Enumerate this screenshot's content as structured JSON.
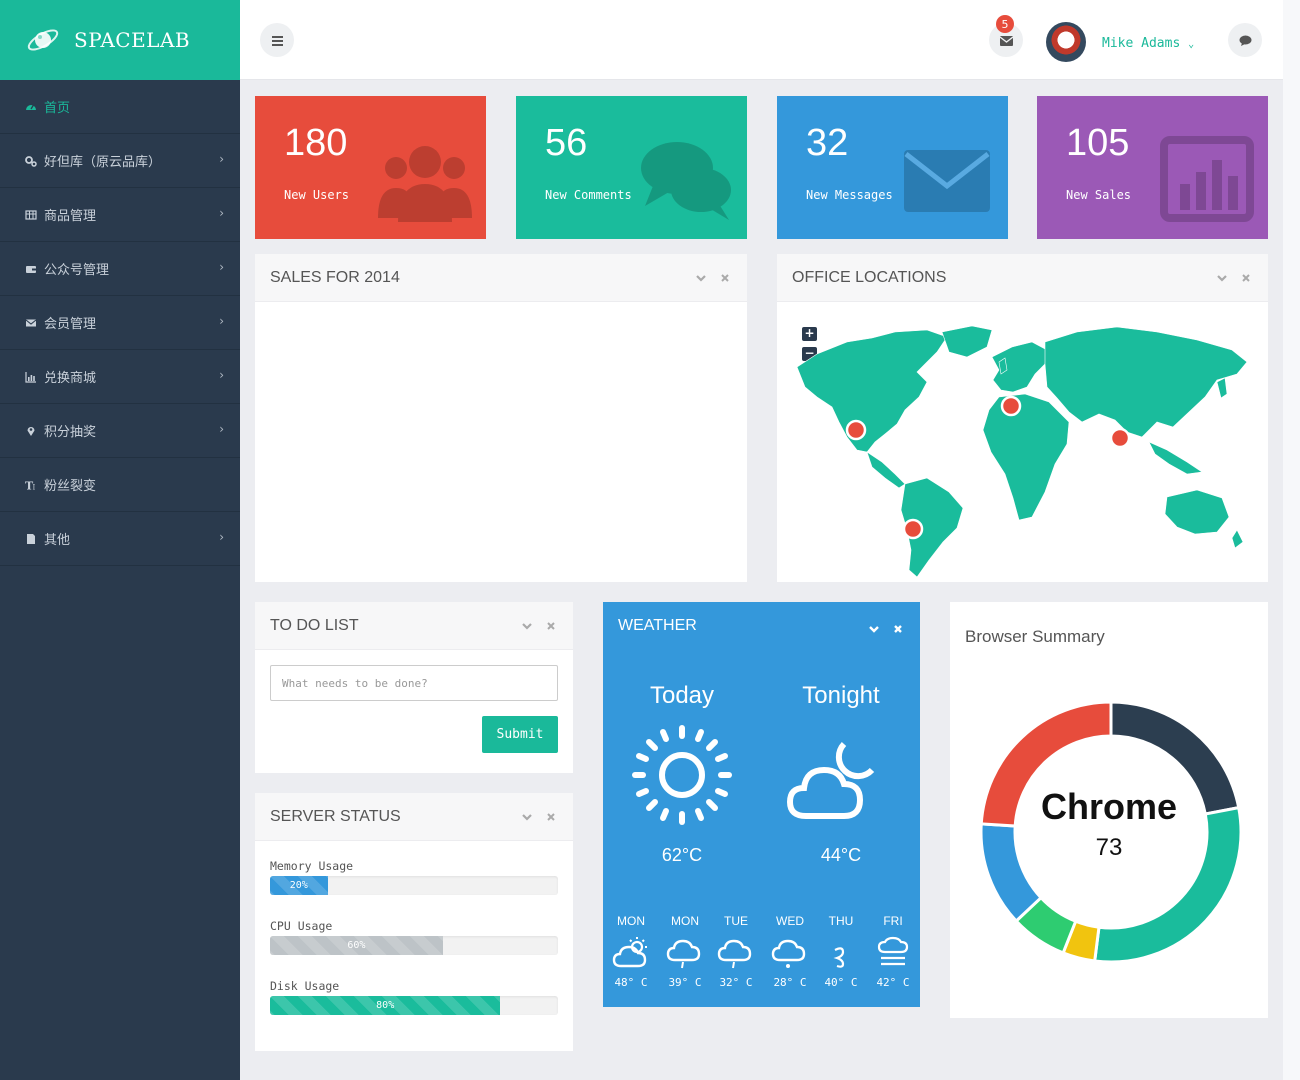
{
  "brand": {
    "name": "SPACELAB"
  },
  "sidebar": {
    "items": [
      {
        "label": "首页",
        "icon": "dashboard-icon",
        "active": true,
        "chevron": false
      },
      {
        "label": "好但库（原云品库）",
        "icon": "cogs-icon",
        "active": false,
        "chevron": true
      },
      {
        "label": "商品管理",
        "icon": "table-icon",
        "active": false,
        "chevron": true
      },
      {
        "label": "公众号管理",
        "icon": "wallet-icon",
        "active": false,
        "chevron": true
      },
      {
        "label": "会员管理",
        "icon": "envelope-icon",
        "active": false,
        "chevron": true
      },
      {
        "label": "兑换商城",
        "icon": "bar-chart-icon",
        "active": false,
        "chevron": true
      },
      {
        "label": "积分抽奖",
        "icon": "map-marker-icon",
        "active": false,
        "chevron": true
      },
      {
        "label": "粉丝裂变",
        "icon": "text-size-icon",
        "active": false,
        "chevron": false
      },
      {
        "label": "其他",
        "icon": "file-icon",
        "active": false,
        "chevron": true
      }
    ]
  },
  "header": {
    "messages_badge": "5",
    "user_name": "Mike Adams"
  },
  "stats": [
    {
      "value": "180",
      "label": "New Users",
      "color": "#e74c3c",
      "icon": "users-icon"
    },
    {
      "value": "56",
      "label": "New Comments",
      "color": "#1abc9c",
      "icon": "comments-icon"
    },
    {
      "value": "32",
      "label": "New Messages",
      "color": "#3498db",
      "icon": "envelope-icon"
    },
    {
      "value": "105",
      "label": "New Sales",
      "color": "#9b59b6",
      "icon": "bar-chart-icon"
    }
  ],
  "sales_panel": {
    "title": "SALES FOR 2014"
  },
  "office_panel": {
    "title": "OFFICE LOCATIONS",
    "zoom_in": "+",
    "zoom_out": "−",
    "map_color": "#1abc9c",
    "marker_color": "#e74c3c"
  },
  "todo_panel": {
    "title": "TO DO LIST",
    "placeholder": "What needs to be done?",
    "submit_label": "Submit"
  },
  "server_panel": {
    "title": "SERVER STATUS",
    "bars": [
      {
        "label": "Memory Usage",
        "percent": 20,
        "text": "20%",
        "color": "#3498db"
      },
      {
        "label": "CPU Usage",
        "percent": 60,
        "text": "60%",
        "color": "#bdc3c7"
      },
      {
        "label": "Disk Usage",
        "percent": 80,
        "text": "80%",
        "color": "#1abc9c"
      }
    ]
  },
  "weather": {
    "title": "WEATHER",
    "today": {
      "label": "Today",
      "temp": "62°C",
      "icon": "sun-icon"
    },
    "tonight": {
      "label": "Tonight",
      "temp": "44°C",
      "icon": "cloud-moon-icon"
    },
    "forecast": [
      {
        "day": "MON",
        "temp": "48° C",
        "icon": "partly-sunny-icon"
      },
      {
        "day": "MON",
        "temp": "39° C",
        "icon": "cloud-rain-icon"
      },
      {
        "day": "TUE",
        "temp": "32° C",
        "icon": "cloud-rain-icon"
      },
      {
        "day": "WED",
        "temp": "28° C",
        "icon": "cloud-snow-icon"
      },
      {
        "day": "THU",
        "temp": "40° C",
        "icon": "wind-icon"
      },
      {
        "day": "FRI",
        "temp": "42° C",
        "icon": "fog-icon"
      }
    ]
  },
  "browser_summary": {
    "title": "Browser Summary",
    "center_label": "Chrome",
    "center_value": "73"
  },
  "chart_data": {
    "type": "pie",
    "title": "Browser Summary",
    "segments": [
      {
        "value": 22,
        "color": "#2c3e50"
      },
      {
        "value": 30,
        "color": "#1abc9c"
      },
      {
        "value": 4,
        "color": "#f1c40f"
      },
      {
        "value": 7,
        "color": "#2ecc71"
      },
      {
        "value": 13,
        "color": "#3498db"
      },
      {
        "value": 24,
        "color": "#e74c3c"
      }
    ],
    "highlighted": {
      "label": "Chrome",
      "value": 73
    }
  }
}
